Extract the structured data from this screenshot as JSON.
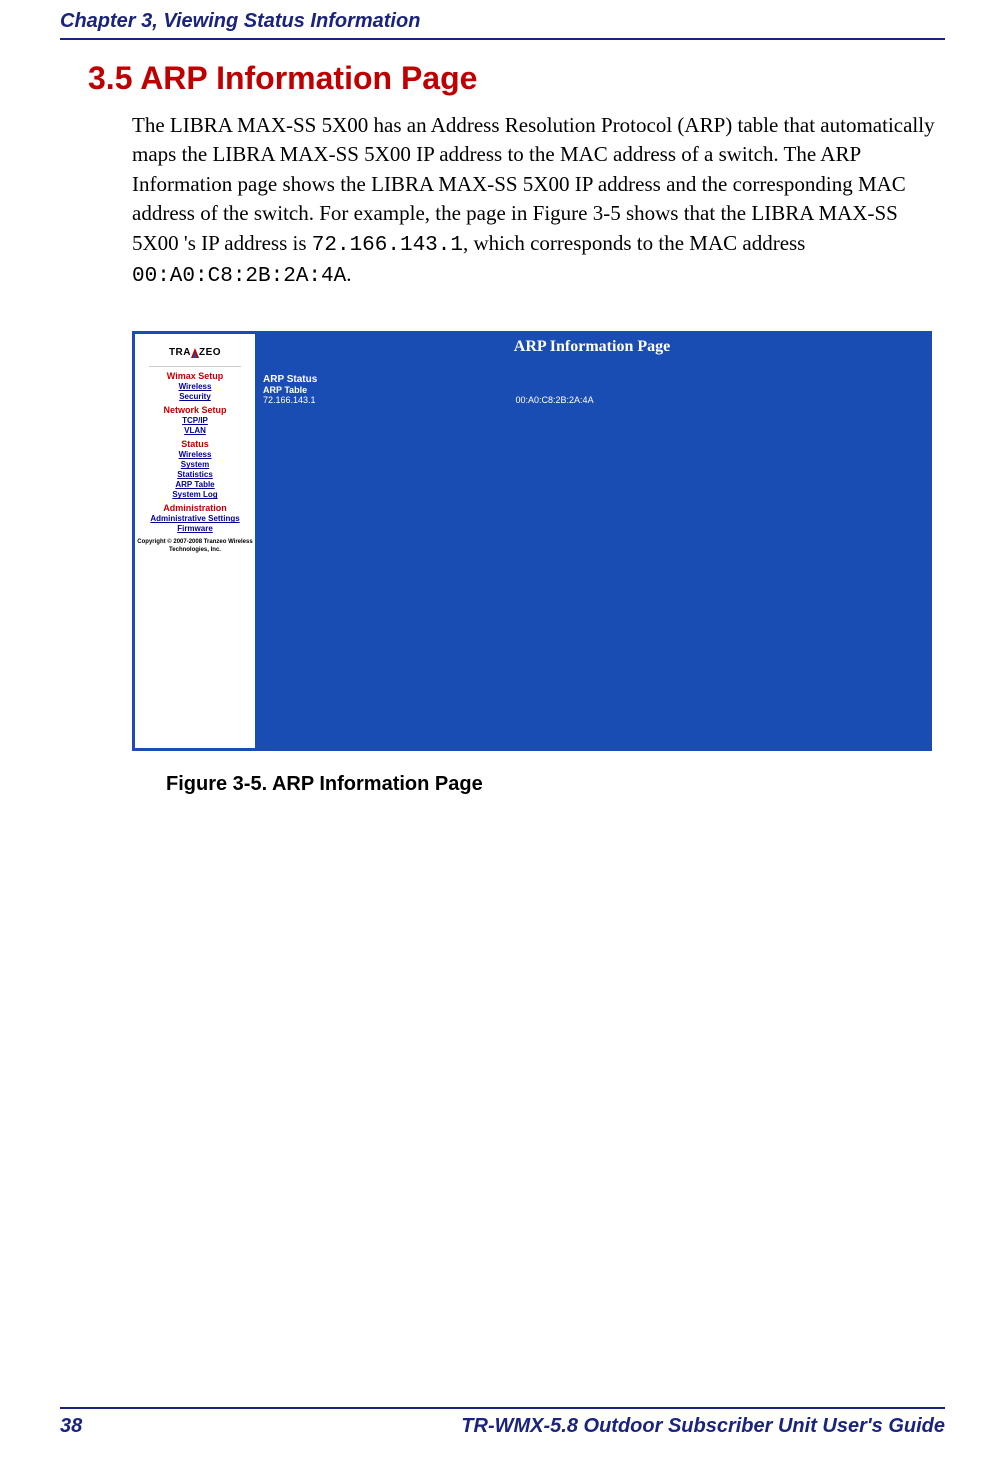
{
  "header": {
    "chapter": "Chapter 3, Viewing Status Information"
  },
  "section": {
    "title": "3.5 ARP Information Page",
    "body_part1": "The LIBRA MAX-SS 5X00  has an Address Resolution Protocol (ARP) table that automatically maps the LIBRA MAX-SS 5X00  IP address to the MAC address of a switch. The ARP Information page shows the LIBRA MAX-SS 5X00  IP address and the corresponding MAC address of the switch. For example, the page in Figure 3-5 shows that the LIBRA MAX-SS 5X00 's IP address is ",
    "body_ip": "72.166.143.1",
    "body_part2": ", which corresponds to the MAC address ",
    "body_mac": "00:A0:C8:2B:2A:4A",
    "body_part3": "."
  },
  "screenshot": {
    "logo": "TRANZEO",
    "nav": {
      "wimax_setup": "Wimax Setup",
      "wireless": "Wireless",
      "security": "Security",
      "network_setup": "Network Setup",
      "tcpip": "TCP/IP",
      "vlan": "VLAN",
      "status": "Status",
      "status_wireless": "Wireless",
      "system": "System",
      "statistics": "Statistics",
      "arp_table": "ARP Table",
      "system_log": "System Log",
      "administration": "Administration",
      "admin_settings": "Administrative Settings",
      "firmware": "Firmware",
      "copyright1": "Copyright © 2007-2008 Tranzeo Wireless",
      "copyright2": "Technologies, Inc."
    },
    "panel": {
      "title": "ARP Information Page",
      "section": "ARP Status",
      "subsection": "ARP Table",
      "row_ip": "72.166.143.1",
      "row_mac": "00:A0:C8:2B:2A:4A"
    }
  },
  "figure_caption": "Figure 3-5. ARP Information Page",
  "footer": {
    "page_number": "38",
    "guide_title": "TR-WMX-5.8 Outdoor Subscriber Unit User's Guide"
  }
}
